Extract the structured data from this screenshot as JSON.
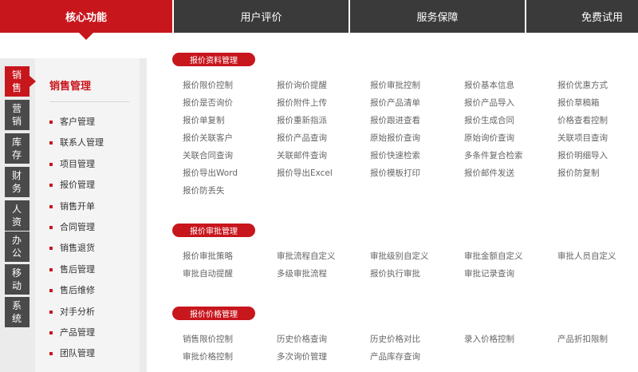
{
  "top_tabs": [
    "核心功能",
    "用户评价",
    "服务保障",
    "免费试用"
  ],
  "side_tabs": [
    [
      "销",
      "售"
    ],
    [
      "营",
      "销"
    ],
    [
      "库",
      "存"
    ],
    [
      "财",
      "务"
    ],
    [
      "人",
      "资"
    ],
    [
      "办",
      "公"
    ],
    [
      "移",
      "动"
    ],
    [
      "系",
      "统"
    ]
  ],
  "submenu": {
    "title": "销售管理",
    "items": [
      "客户管理",
      "联系人管理",
      "项目管理",
      "报价管理",
      "销售开单",
      "合同管理",
      "销售退货",
      "售后管理",
      "售后维修",
      "对手分析",
      "产品管理",
      "团队管理"
    ]
  },
  "sections": [
    {
      "title": "报价资料管理",
      "items": [
        "报价限价控制",
        "报价询价提醒",
        "报价审批控制",
        "报价基本信息",
        "报价优惠方式",
        "报价是否询价",
        "报价附件上传",
        "报价产品清单",
        "报价产品导入",
        "报价草稿箱",
        "报价单复制",
        "报价重新指派",
        "报价跟进查看",
        "报价生成合同",
        "价格查看控制",
        "报价关联客户",
        "报价产品查询",
        "原始报价查询",
        "原始询价查询",
        "关联项目查询",
        "关联合同查询",
        "关联邮件查询",
        "报价快速检索",
        "多条件复合检索",
        "报价明细导入",
        "报价导出Word",
        "报价导出Excel",
        "报价模板打印",
        "报价邮件发送",
        "报价防复制",
        "报价防丢失"
      ]
    },
    {
      "title": "报价审批管理",
      "items": [
        "报价审批策略",
        "审批流程自定义",
        "审批级别自定义",
        "审批金额自定义",
        "审批人员自定义",
        "审批自动提醒",
        "多级审批流程",
        "报价执行审批",
        "审批记录查询"
      ]
    },
    {
      "title": "报价价格管理",
      "items": [
        "销售限价控制",
        "历史价格查询",
        "历史价格对比",
        "录入价格控制",
        "产品折扣限制",
        "审批价格控制",
        "多次询价管理",
        "产品库存查询"
      ]
    }
  ]
}
